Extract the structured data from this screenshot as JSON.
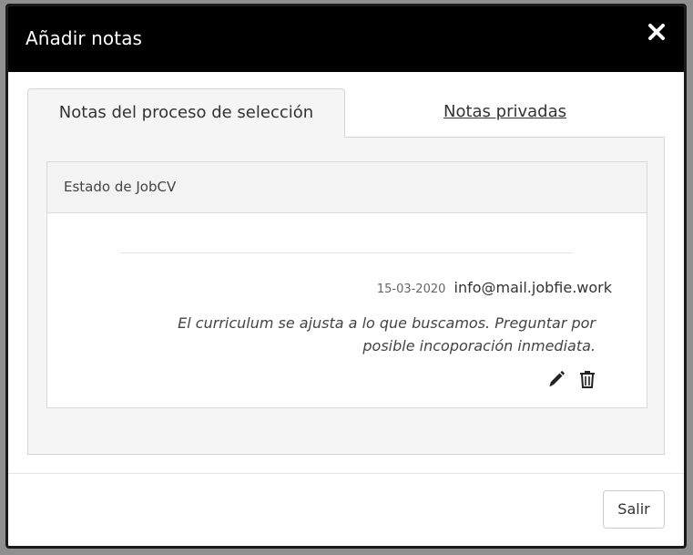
{
  "modal": {
    "title": "Añadir notas",
    "close_icon": "close-icon"
  },
  "tabs": [
    {
      "label": "Notas del proceso de selección",
      "active": true
    },
    {
      "label": "Notas privadas",
      "active": false
    }
  ],
  "card": {
    "header": "Estado de JobCV",
    "notes": [
      {
        "date": "15-03-2020",
        "author": "info@mail.jobfie.work",
        "text": "El curriculum se ajusta a lo que buscamos. Preguntar por posible incoporación inmediata.",
        "edit_icon": "pencil-icon",
        "delete_icon": "trash-icon"
      }
    ]
  },
  "footer": {
    "exit_label": "Salir"
  },
  "colors": {
    "header_bg": "#000000",
    "header_text": "#ffffff",
    "panel_bg": "#f5f5f5",
    "border": "#d6d6d6"
  }
}
